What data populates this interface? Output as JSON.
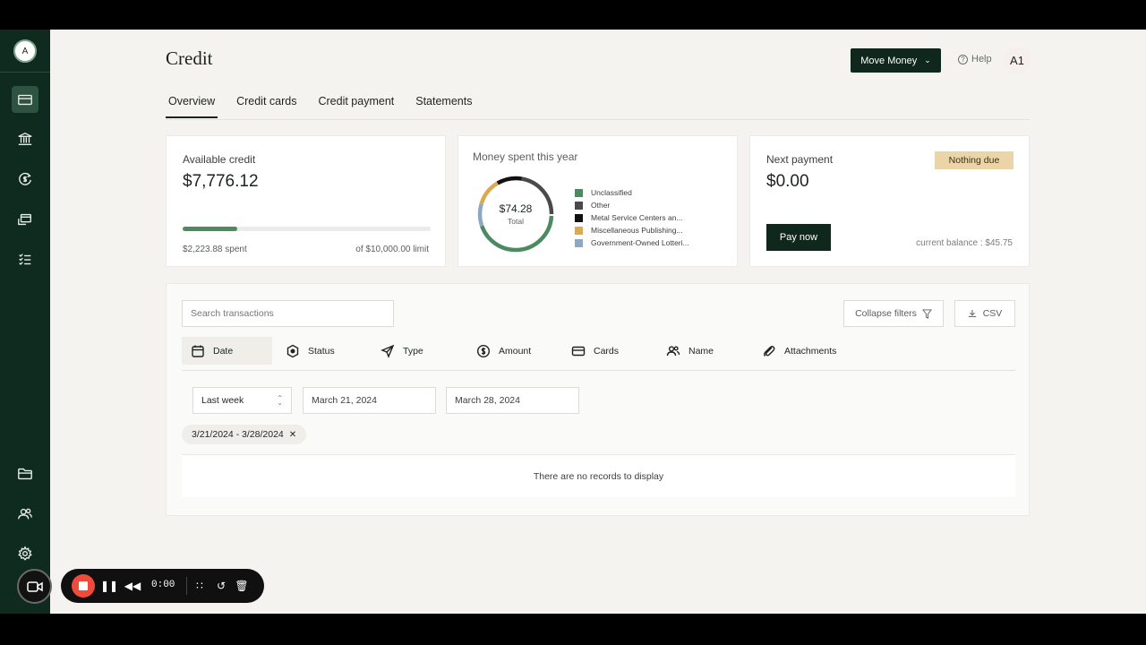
{
  "sidebar": {
    "avatar": "A",
    "icons": [
      "credit-card-icon",
      "bank-icon",
      "refresh-dollar-icon",
      "transfer-icon",
      "checklist-icon",
      "folder-icon",
      "users-icon",
      "gear-icon"
    ]
  },
  "header": {
    "title": "Credit",
    "move_money": "Move Money",
    "help": "Help",
    "user_initials": "A1"
  },
  "tabs": [
    {
      "label": "Overview",
      "active": true
    },
    {
      "label": "Credit cards"
    },
    {
      "label": "Credit payment"
    },
    {
      "label": "Statements"
    }
  ],
  "available_credit": {
    "label": "Available credit",
    "value": "$7,776.12",
    "spent": "$2,223.88 spent",
    "limit": "of $10,000.00 limit",
    "progress": 0.22
  },
  "money_spent": {
    "label": "Money spent this year",
    "total_amount": "$74.28",
    "total_label": "Total",
    "legend": [
      {
        "label": "Unclassified",
        "color": "#4c8a62"
      },
      {
        "label": "Other",
        "color": "#4a4a4a"
      },
      {
        "label": "Metal Service Centers an...",
        "color": "#111111"
      },
      {
        "label": "Miscellaneous Publishing...",
        "color": "#d9a954"
      },
      {
        "label": "Government-Owned Lotteri...",
        "color": "#8fa8c2"
      }
    ]
  },
  "next_payment": {
    "label": "Next payment",
    "value": "$0.00",
    "badge": "Nothing due",
    "pay_button": "Pay now",
    "current_balance": "current balance : $45.75"
  },
  "transactions": {
    "search_placeholder": "Search transactions",
    "collapse_filters": "Collapse filters",
    "csv": "CSV",
    "filters": [
      "Date",
      "Status",
      "Type",
      "Amount",
      "Cards",
      "Name",
      "Attachments"
    ],
    "range_select": "Last week",
    "start_date": "March 21, 2024",
    "end_date": "March 28, 2024",
    "chip": "3/21/2024 - 3/28/2024",
    "empty_message": "There are no records to display"
  },
  "recorder": {
    "time": "0:00"
  }
}
